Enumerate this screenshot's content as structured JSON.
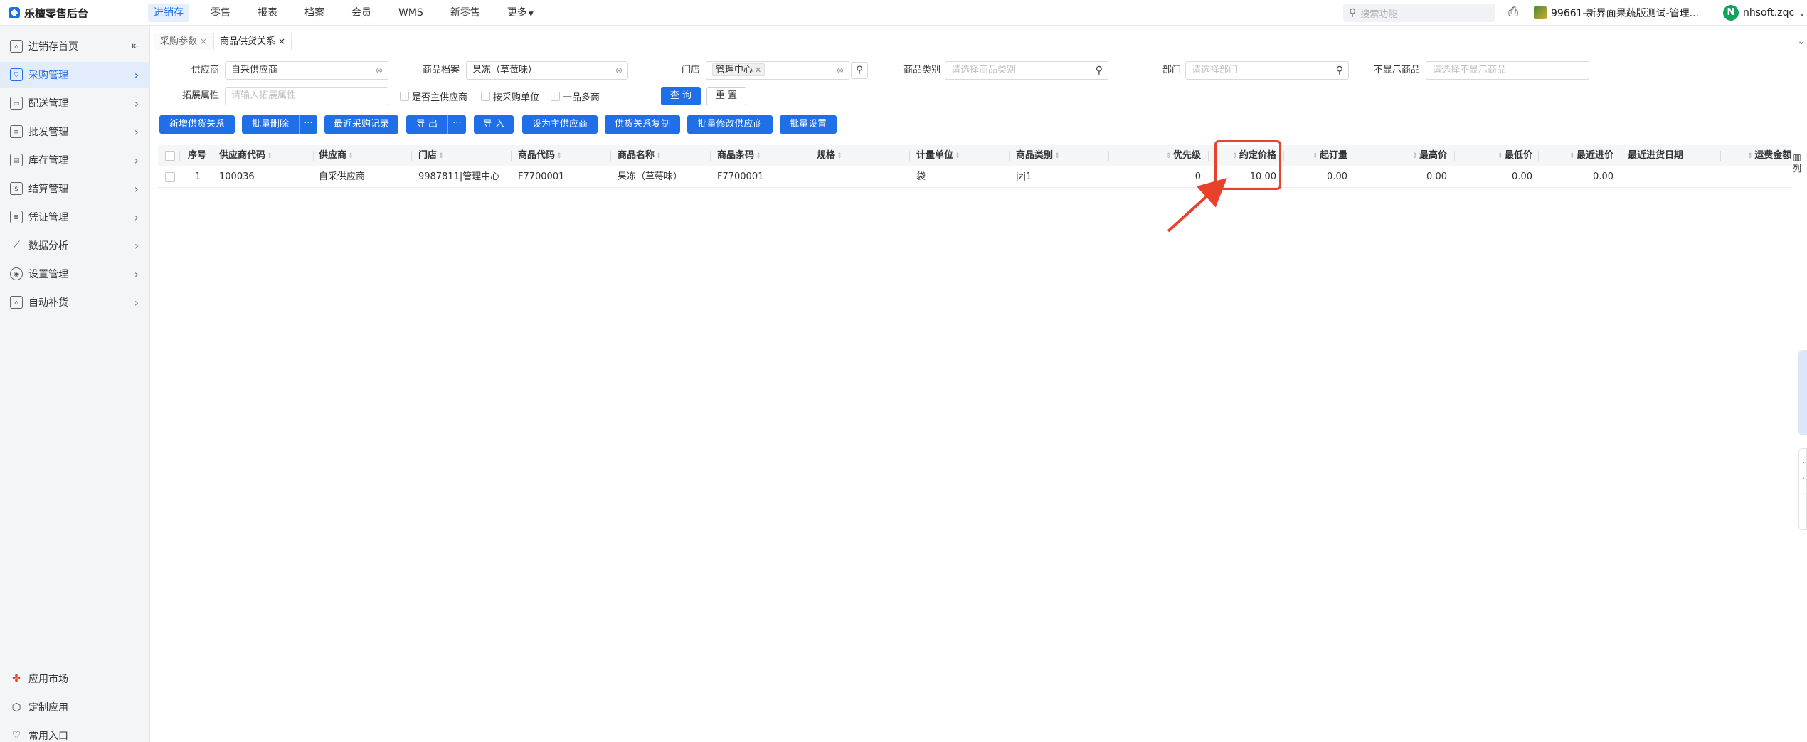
{
  "app": {
    "title": "乐檀零售后台",
    "top_nav": [
      "进销存",
      "零售",
      "报表",
      "档案",
      "会员",
      "WMS",
      "新零售",
      "更多"
    ],
    "active_nav": "进销存",
    "search_placeholder": "搜索功能",
    "store_name": "99661-新界面果蔬版测试-管理...",
    "user_initial": "N",
    "user_name": "nhsoft.zqc"
  },
  "sidebar": {
    "items": [
      {
        "label": "进销存首页",
        "icon": "home-icon"
      },
      {
        "label": "采购管理",
        "icon": "cart-icon"
      },
      {
        "label": "配送管理",
        "icon": "truck-icon"
      },
      {
        "label": "批发管理",
        "icon": "wholesale-icon"
      },
      {
        "label": "库存管理",
        "icon": "inventory-icon"
      },
      {
        "label": "结算管理",
        "icon": "settlement-icon"
      },
      {
        "label": "凭证管理",
        "icon": "voucher-icon"
      },
      {
        "label": "数据分析",
        "icon": "chart-icon"
      },
      {
        "label": "设置管理",
        "icon": "gear-icon"
      },
      {
        "label": "自动补货",
        "icon": "replenish-icon"
      }
    ],
    "bottom_items": [
      {
        "label": "应用市场",
        "icon": "apps-icon"
      },
      {
        "label": "定制应用",
        "icon": "cube-icon"
      },
      {
        "label": "常用入口",
        "icon": "heart-icon"
      }
    ]
  },
  "tabs": [
    {
      "label": "采购参数"
    },
    {
      "label": "商品供货关系"
    }
  ],
  "filters": {
    "supplier_label": "供应商",
    "supplier_value": "自采供应商",
    "product_label": "商品档案",
    "product_value": "果冻（草莓味）",
    "store_label": "门店",
    "store_value": "管理中心",
    "category_label": "商品类别",
    "category_placeholder": "请选择商品类别",
    "dept_label": "部门",
    "dept_placeholder": "请选择部门",
    "hidden_label": "不显示商品",
    "hidden_placeholder": "请选择不显示商品",
    "ext_label": "拓展属性",
    "ext_placeholder": "请输入拓展属性",
    "chk_main_supplier": "是否主供应商",
    "chk_purchase_unit": "按采购单位",
    "chk_one_product_multi": "一品多商",
    "query": "查 询",
    "reset": "重 置"
  },
  "toolbar": {
    "add": "新增供货关系",
    "batch_delete": "批量删除",
    "more": "···",
    "recent_records": "最近采购记录",
    "export": "导 出",
    "import": "导 入",
    "set_main": "设为主供应商",
    "copy": "供货关系复制",
    "batch_edit_supplier": "批量修改供应商",
    "batch_settings": "批量设置"
  },
  "table": {
    "headers": [
      "序号",
      "供应商代码",
      "供应商",
      "门店",
      "商品代码",
      "商品名称",
      "商品条码",
      "规格",
      "计量单位",
      "商品类别",
      "优先级",
      "约定价格",
      "起订量",
      "最高价",
      "最低价",
      "最近进价",
      "最近进货日期",
      "运费金额"
    ],
    "rows": [
      {
        "index": "1",
        "supplier_code": "100036",
        "supplier": "自采供应商",
        "store": "9987811|管理中心",
        "product_code": "F7700001",
        "product_name": "果冻（草莓味）",
        "barcode": "F7700001",
        "spec": "",
        "unit": "袋",
        "category": "jzj1",
        "priority": "0",
        "agreed_price": "10.00",
        "min_order": "0.00",
        "max_price": "0.00",
        "min_price": "0.00",
        "recent_price": "0.00",
        "recent_date": "",
        "freight": ""
      }
    ],
    "column_setting": "列"
  },
  "colors": {
    "primary": "#1e6fe8",
    "annotation": "#e8412c"
  }
}
